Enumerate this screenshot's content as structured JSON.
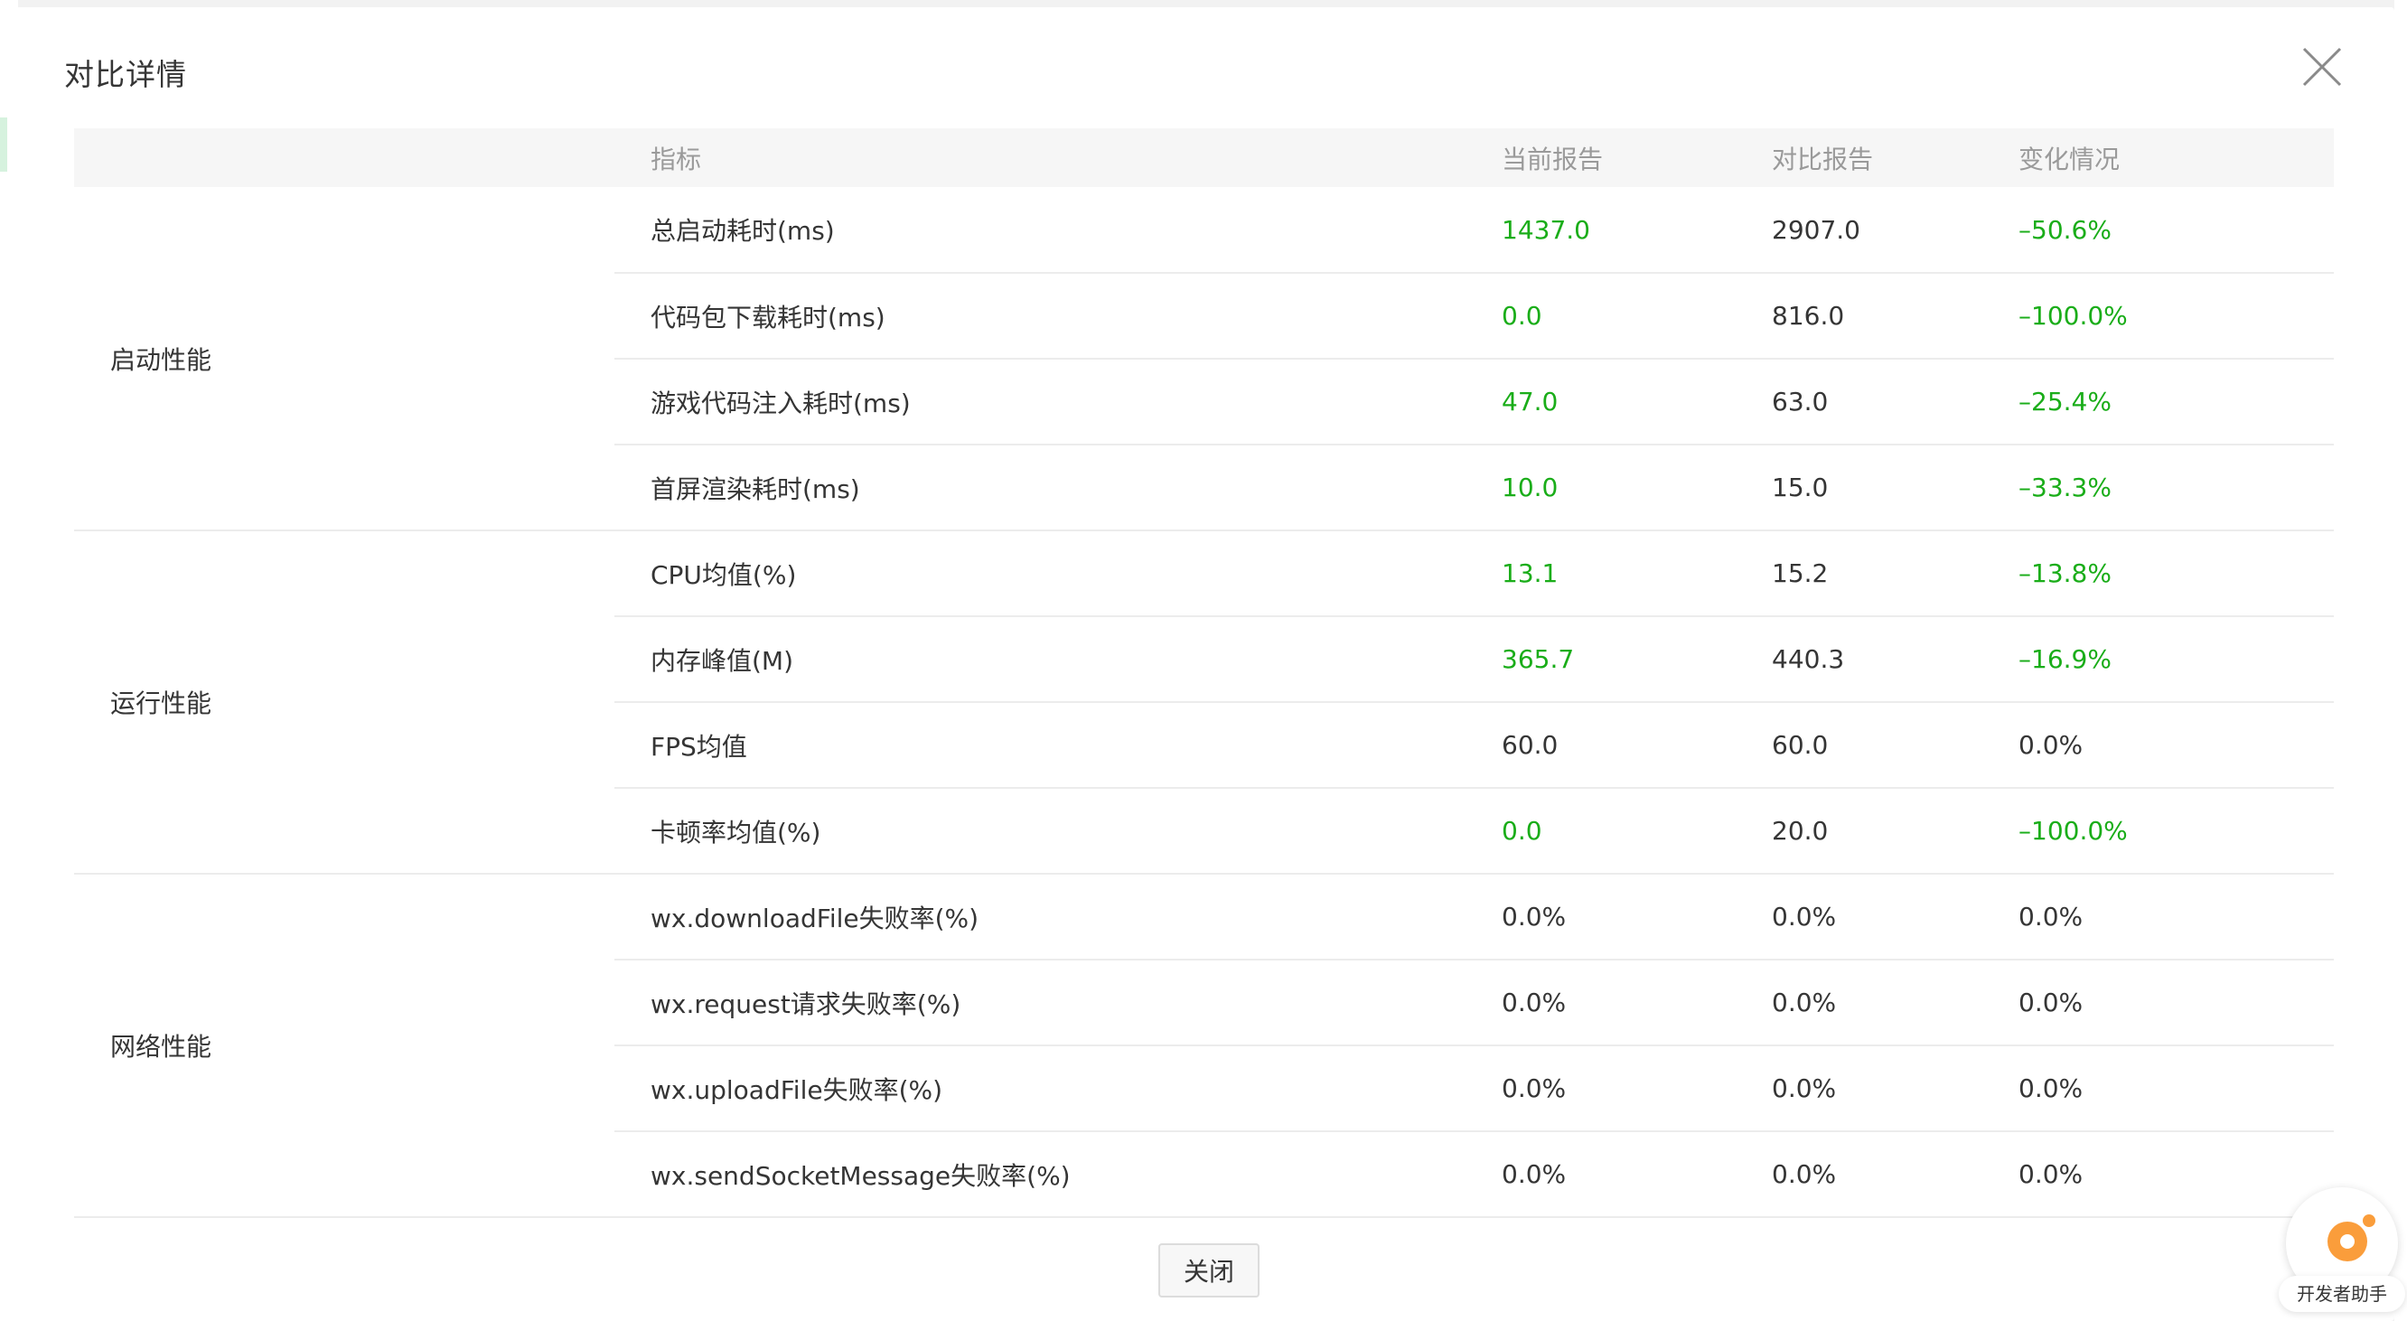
{
  "dialog": {
    "title": "对比详情",
    "close_button_label": "关闭"
  },
  "table": {
    "headers": {
      "metric": "指标",
      "current": "当前报告",
      "baseline": "对比报告",
      "change": "变化情况"
    },
    "groups": [
      {
        "name": "启动性能",
        "rows": [
          {
            "metric": "总启动耗时(ms)",
            "current": "1437.0",
            "baseline": "2907.0",
            "change": "–50.6%",
            "improved": true
          },
          {
            "metric": "代码包下载耗时(ms)",
            "current": "0.0",
            "baseline": "816.0",
            "change": "–100.0%",
            "improved": true
          },
          {
            "metric": "游戏代码注入耗时(ms)",
            "current": "47.0",
            "baseline": "63.0",
            "change": "–25.4%",
            "improved": true
          },
          {
            "metric": "首屏渲染耗时(ms)",
            "current": "10.0",
            "baseline": "15.0",
            "change": "–33.3%",
            "improved": true
          }
        ]
      },
      {
        "name": "运行性能",
        "rows": [
          {
            "metric": "CPU均值(%)",
            "current": "13.1",
            "baseline": "15.2",
            "change": "–13.8%",
            "improved": true
          },
          {
            "metric": "内存峰值(M)",
            "current": "365.7",
            "baseline": "440.3",
            "change": "–16.9%",
            "improved": true
          },
          {
            "metric": "FPS均值",
            "current": "60.0",
            "baseline": "60.0",
            "change": "0.0%",
            "improved": false
          },
          {
            "metric": "卡顿率均值(%)",
            "current": "0.0",
            "baseline": "20.0",
            "change": "–100.0%",
            "improved": true
          }
        ]
      },
      {
        "name": "网络性能",
        "rows": [
          {
            "metric": "wx.downloadFile失败率(%)",
            "current": "0.0%",
            "baseline": "0.0%",
            "change": "0.0%",
            "improved": false
          },
          {
            "metric": "wx.request请求失败率(%)",
            "current": "0.0%",
            "baseline": "0.0%",
            "change": "0.0%",
            "improved": false
          },
          {
            "metric": "wx.uploadFile失败率(%)",
            "current": "0.0%",
            "baseline": "0.0%",
            "change": "0.0%",
            "improved": false
          },
          {
            "metric": "wx.sendSocketMessage失败率(%)",
            "current": "0.0%",
            "baseline": "0.0%",
            "change": "0.0%",
            "improved": false
          }
        ]
      }
    ]
  },
  "helper": {
    "label": "开发者助手",
    "icon": "dev-assistant-icon"
  },
  "colors": {
    "improved": "#1aad19",
    "text": "#353535",
    "header_text": "#9a9a9a",
    "header_bg": "#f6f6f6",
    "helper_accent": "#fa9d3b"
  }
}
